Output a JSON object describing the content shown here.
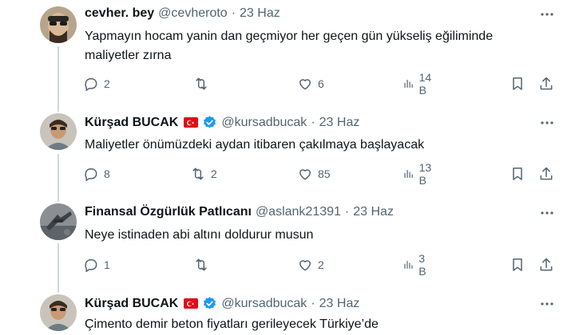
{
  "tweets": [
    {
      "name": "cevher. bey",
      "handle": "@cevheroto",
      "separator": "·",
      "date": "23 Haz",
      "verified": false,
      "flag": false,
      "text_lines": [
        "Yapmayın hocam yanin dan geçmiyor  her geçen gün yükseliş eğiliminde",
        "maliyetler  zırna"
      ],
      "replies": "2",
      "retweets": "",
      "likes": "6",
      "views": "14 B"
    },
    {
      "name": "Kürşad BUCAK",
      "handle": "@kursadbucak",
      "separator": "·",
      "date": "23 Haz",
      "verified": true,
      "flag": true,
      "text_lines": [
        "Maliyetler önümüzdeki aydan itibaren çakılmaya başlayacak"
      ],
      "replies": "8",
      "retweets": "2",
      "likes": "85",
      "views": "13 B"
    },
    {
      "name": "Finansal Özgürlük Patlıcanı",
      "handle": "@aslank21391",
      "separator": "·",
      "date": "23 Haz",
      "verified": false,
      "flag": false,
      "text_lines": [
        "Neye istinaden abi altını doldurur musun"
      ],
      "replies": "1",
      "retweets": "",
      "likes": "2",
      "views": "3 B"
    },
    {
      "name": "Kürşad BUCAK",
      "handle": "@kursadbucak",
      "separator": "·",
      "date": "23 Haz",
      "verified": true,
      "flag": true,
      "text_lines": [
        "Çimento demir beton fiyatları gerileyecek Türkiye’de"
      ]
    }
  ],
  "colors": {
    "text": "#0f1419",
    "secondary": "#536471",
    "verified": "#1d9bf0",
    "flag": "#e30a17",
    "thread_line": "#cfd9de"
  },
  "icons": [
    "reply-icon",
    "retweet-icon",
    "like-icon",
    "views-icon",
    "bookmark-icon",
    "share-icon",
    "more-icon"
  ]
}
